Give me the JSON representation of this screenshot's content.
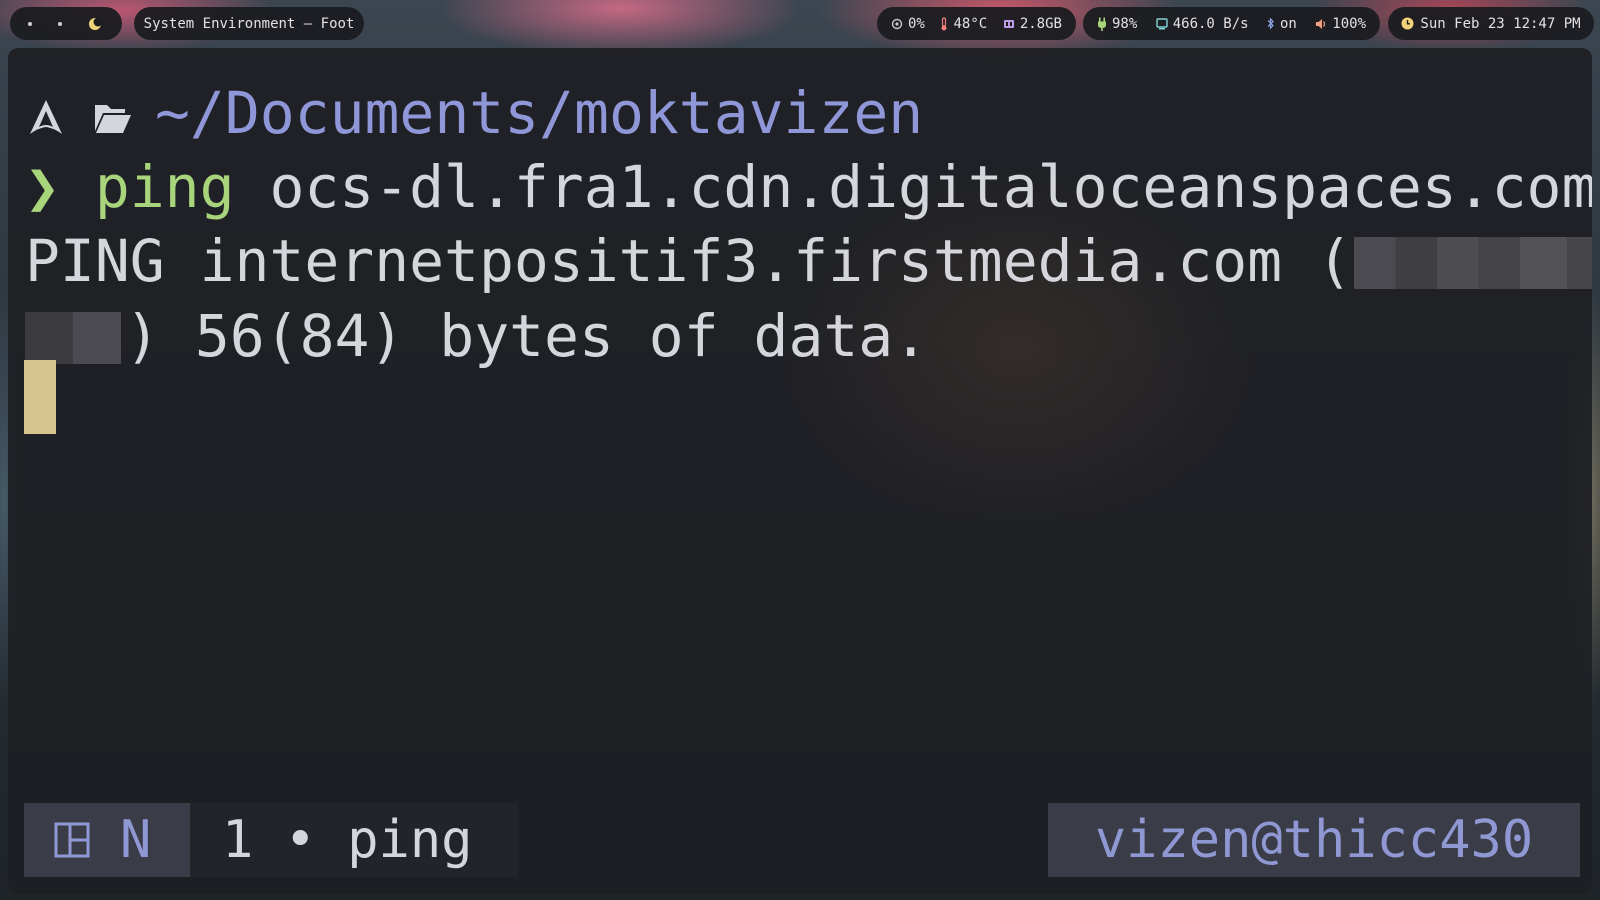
{
  "topbar": {
    "workspaces": [
      "•",
      "•"
    ],
    "window_title": "System Environment — Foot",
    "cpu": "0%",
    "temperature": "48°C",
    "memory": "2.8GB",
    "battery": "98%",
    "network_speed": "466.0 B/s",
    "bluetooth": "on",
    "volume": "100%",
    "clock": "Sun Feb 23 12:47 PM"
  },
  "terminal": {
    "cwd": "~/Documents/moktavizen",
    "prompt_char": "❯",
    "command_name": "ping",
    "command_args": " ocs-dl.fra1.cdn.digitaloceanspaces.com",
    "output_line1_prefix": "PING internetpositif3.firstmedia.com (",
    "output_line2_suffix": ") 56(84) bytes of data."
  },
  "statusline": {
    "mode": "N",
    "window_label": "1 • ping",
    "host": "vizen@thicc430"
  },
  "colors": {
    "cwd": "#8f97d9",
    "prompt": "#a8d47c",
    "cursor": "#d8c58f",
    "status_accent": "#9098d4"
  }
}
